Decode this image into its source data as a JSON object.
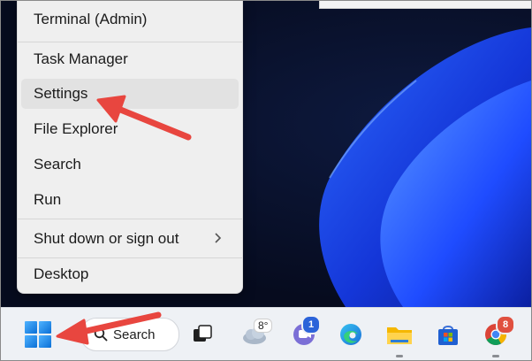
{
  "context_menu": {
    "items": [
      {
        "label": "Terminal (Admin)"
      },
      {
        "label": "Task Manager"
      },
      {
        "label": "Settings"
      },
      {
        "label": "File Explorer"
      },
      {
        "label": "Search"
      },
      {
        "label": "Run"
      },
      {
        "label": "Shut down or sign out"
      },
      {
        "label": "Desktop"
      }
    ]
  },
  "taskbar": {
    "search_label": "Search",
    "weather_temp": "8°",
    "teams_badge": "1",
    "chrome_badge": "8"
  },
  "colors": {
    "annotation_arrow": "#e8463f",
    "menu_bg": "#efefef",
    "taskbar_bg": "#eef1f5",
    "accent_blue": "#1a5cff"
  }
}
